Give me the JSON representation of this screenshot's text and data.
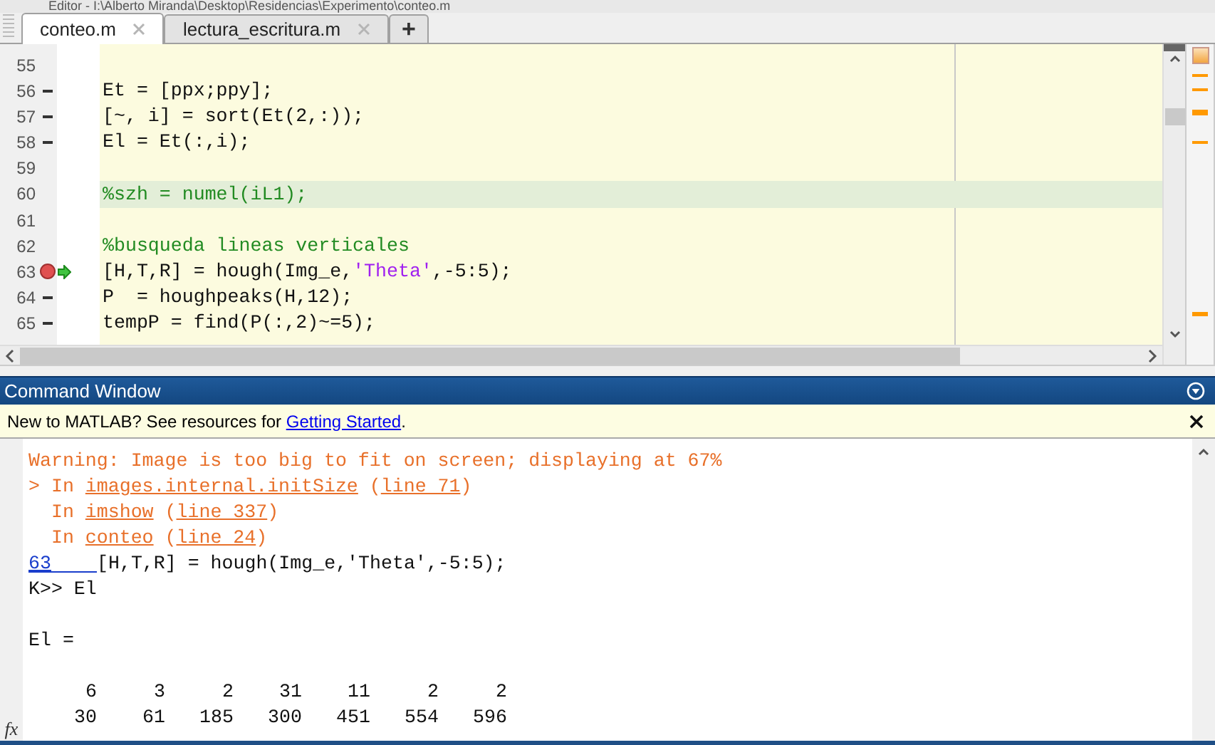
{
  "window": {
    "title": "Editor - I:\\Alberto Miranda\\Desktop\\Residencias\\Experimento\\conteo.m"
  },
  "tabs": [
    {
      "label": "conteo.m",
      "selected": true
    },
    {
      "label": "lectura_escritura.m",
      "selected": false
    }
  ],
  "new_tab": "+",
  "editor": {
    "lines": [
      {
        "number": "55",
        "executable": false,
        "breakpoint": false,
        "current": false,
        "highlighted": false
      },
      {
        "number": "56",
        "executable": true,
        "breakpoint": false,
        "current": false,
        "highlighted": false,
        "segments": [
          {
            "kind": "code",
            "text": "Et = [ppx;ppy];"
          }
        ]
      },
      {
        "number": "57",
        "executable": true,
        "breakpoint": false,
        "current": false,
        "highlighted": false,
        "segments": [
          {
            "kind": "code",
            "text": "[~, i] = sort(Et(2,:));"
          }
        ]
      },
      {
        "number": "58",
        "executable": true,
        "breakpoint": false,
        "current": false,
        "highlighted": false,
        "segments": [
          {
            "kind": "code",
            "text": "El = Et(:,i);"
          }
        ]
      },
      {
        "number": "59",
        "executable": false,
        "breakpoint": false,
        "current": false,
        "highlighted": false
      },
      {
        "number": "60",
        "executable": false,
        "breakpoint": false,
        "current": false,
        "highlighted": true,
        "segments": [
          {
            "kind": "comment",
            "text": "%szh = numel(iL1);"
          }
        ]
      },
      {
        "number": "61",
        "executable": false,
        "breakpoint": false,
        "current": false,
        "highlighted": false
      },
      {
        "number": "62",
        "executable": false,
        "breakpoint": false,
        "current": false,
        "highlighted": false,
        "segments": [
          {
            "kind": "comment",
            "text": "%busqueda lineas verticales"
          }
        ]
      },
      {
        "number": "63",
        "executable": true,
        "breakpoint": true,
        "current": true,
        "highlighted": false,
        "segments": [
          {
            "kind": "code",
            "text": "[H,T,R] = hough(Img_e,"
          },
          {
            "kind": "string",
            "text": "'Theta'"
          },
          {
            "kind": "code",
            "text": ",-5:5);"
          }
        ]
      },
      {
        "number": "64",
        "executable": true,
        "breakpoint": false,
        "current": false,
        "highlighted": false,
        "segments": [
          {
            "kind": "code",
            "text": "P  = houghpeaks(H,12);"
          }
        ]
      },
      {
        "number": "65",
        "executable": true,
        "breakpoint": false,
        "current": false,
        "highlighted": false,
        "segments": [
          {
            "kind": "code",
            "text": "tempP = find(P(:,2)~=5);"
          }
        ]
      }
    ]
  },
  "command_window": {
    "title": "Command Window",
    "info_bar": {
      "text": "New to MATLAB? See resources for ",
      "link": "Getting Started",
      "suffix": "."
    },
    "lines": [
      {
        "kind": "text",
        "segments": [
          {
            "kind": "warning",
            "text": "Warning: Image is too big to fit on screen; displaying at 67%"
          }
        ]
      },
      {
        "kind": "text",
        "segments": [
          {
            "kind": "warning",
            "text": "> In "
          },
          {
            "kind": "warning-link",
            "text": "images.internal.initSize"
          },
          {
            "kind": "warning",
            "text": " ("
          },
          {
            "kind": "warning-link",
            "text": "line 71"
          },
          {
            "kind": "warning",
            "text": ")"
          }
        ]
      },
      {
        "kind": "text",
        "segments": [
          {
            "kind": "warning",
            "text": "  In "
          },
          {
            "kind": "warning-link",
            "text": "imshow"
          },
          {
            "kind": "warning",
            "text": " ("
          },
          {
            "kind": "warning-link",
            "text": "line 337"
          },
          {
            "kind": "warning",
            "text": ")"
          }
        ]
      },
      {
        "kind": "text",
        "segments": [
          {
            "kind": "warning",
            "text": "  In "
          },
          {
            "kind": "warning-link",
            "text": "conteo"
          },
          {
            "kind": "warning",
            "text": " ("
          },
          {
            "kind": "warning-link",
            "text": "line 24"
          },
          {
            "kind": "warning",
            "text": ")"
          }
        ]
      },
      {
        "kind": "text",
        "segments": [
          {
            "kind": "line-link",
            "text": "63"
          },
          {
            "kind": "plain",
            "text": "[H,T,R] = hough(Img_e,'Theta',-5:5);"
          }
        ]
      },
      {
        "kind": "text",
        "segments": [
          {
            "kind": "plain",
            "text": "K>> El"
          }
        ]
      },
      {
        "kind": "blank"
      },
      {
        "kind": "text",
        "segments": [
          {
            "kind": "plain",
            "text": "El ="
          }
        ]
      },
      {
        "kind": "blank"
      },
      {
        "kind": "matrix",
        "rows": [
          [
            "6",
            "3",
            "2",
            "31",
            "11",
            "2",
            "2"
          ],
          [
            "30",
            "61",
            "185",
            "300",
            "451",
            "554",
            "596"
          ]
        ]
      }
    ],
    "fx": "fx"
  }
}
